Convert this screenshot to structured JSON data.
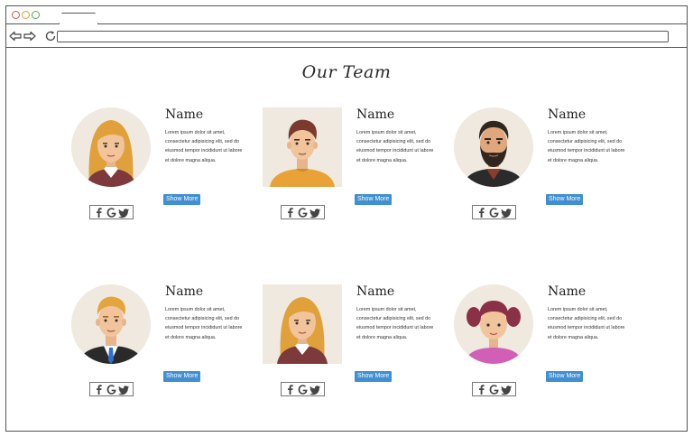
{
  "browser": {
    "tab_label": "",
    "address": ""
  },
  "page": {
    "title": "Our Team"
  },
  "members": [
    {
      "name": "Name",
      "description": "Lorem ipsum dolor sit amet, consectetur adipisicing elit, sed do eiusmod tempor incididunt ut labore et dolore magna aliqua.",
      "button": "Show More",
      "avatar": "woman-blonde-avatar",
      "shape": "circle"
    },
    {
      "name": "Name",
      "description": "Lorem ipsum dolor sit amet, consectetur adipisicing elit, sed do eiusmod tempor incididunt ut labore et dolore magna aliqua.",
      "button": "Show More",
      "avatar": "man-orange-shirt-avatar",
      "shape": "square"
    },
    {
      "name": "Name",
      "description": "Lorem ipsum dolor sit amet, consectetur adipisicing elit, sed do eiusmod tempor incididunt ut labore et dolore magna aliqua.",
      "button": "Show More",
      "avatar": "man-beard-avatar",
      "shape": "circle"
    },
    {
      "name": "Name",
      "description": "Lorem ipsum dolor sit amet, consectetur adipisicing elit, sed do eiusmod tempor incididunt ut labore et dolore magna aliqua.",
      "button": "Show More",
      "avatar": "man-suit-avatar",
      "shape": "circle"
    },
    {
      "name": "Name",
      "description": "Lorem ipsum dolor sit amet, consectetur adipisicing elit, sed do eiusmod tempor incididunt ut labore et dolore magna aliqua.",
      "button": "Show More",
      "avatar": "woman-blonde-avatar",
      "shape": "square"
    },
    {
      "name": "Name",
      "description": "Lorem ipsum dolor sit amet, consectetur adipisicing elit, sed do eiusmod tempor incididunt ut labore et dolore magna aliqua.",
      "button": "Show More",
      "avatar": "girl-pigtails-avatar",
      "shape": "circle"
    }
  ],
  "social_icons": [
    "facebook-icon",
    "google-icon",
    "twitter-icon"
  ],
  "colors": {
    "button": "#3f8fd2",
    "avatar_bg": "#efe9df",
    "window_border": "#555555",
    "dot_red": "#d9534f",
    "dot_yellow": "#e0a02c",
    "dot_green": "#4caf50"
  }
}
